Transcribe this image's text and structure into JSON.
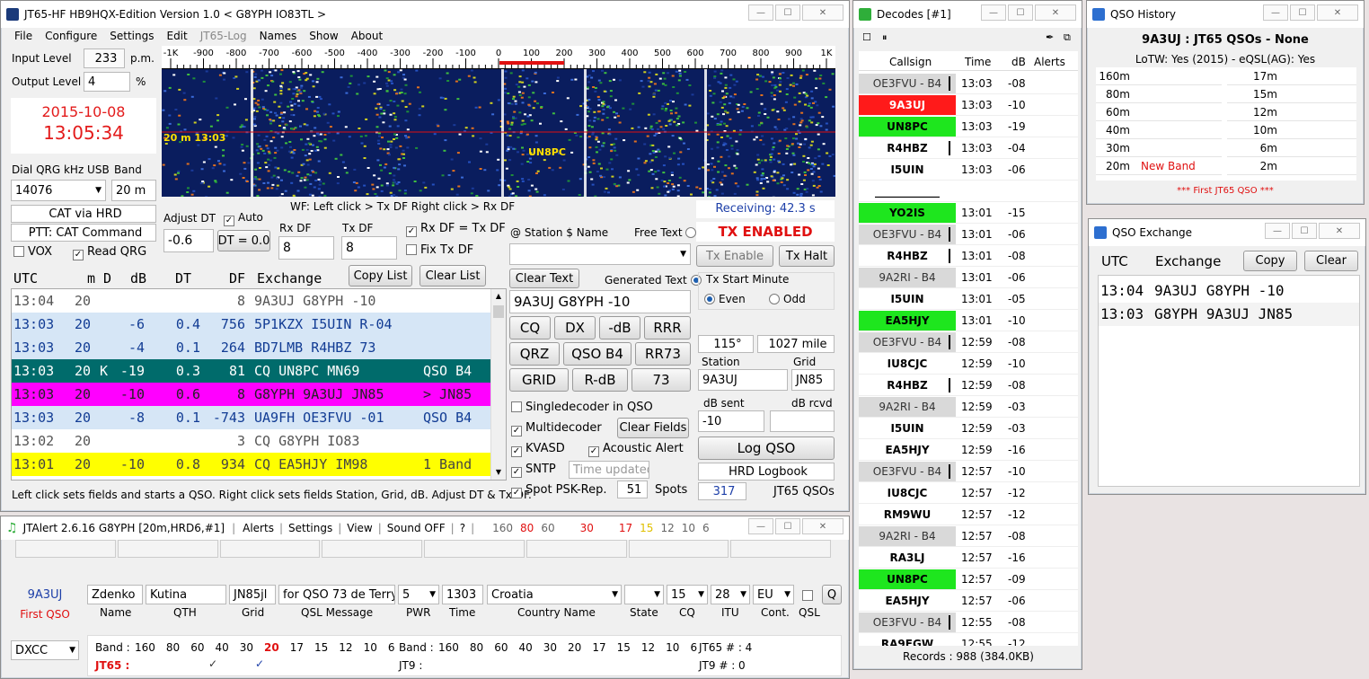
{
  "jt65": {
    "title": "JT65-HF HB9HQX-Edition Version 1.0   < G8YPH IO83TL >",
    "menu": [
      "File",
      "Configure",
      "Settings",
      "Edit",
      "JT65-Log",
      "Names",
      "Show",
      "About"
    ],
    "input_level_label": "Input Level",
    "input_level": "233",
    "pm": "p.m.",
    "output_level_label": "Output Level",
    "output_level": "4",
    "pct": "%",
    "date": "2015-10-08",
    "time": "13:05:34",
    "dial_label": "Dial QRG kHz USB",
    "band_label": "Band",
    "dial": "14076",
    "band": "20 m",
    "cat": "CAT via HRD",
    "ptt": "PTT: CAT Command",
    "vox": "VOX",
    "read_qrg": "Read QRG",
    "wf_scale": [
      "-1K",
      "-900",
      "-800",
      "-700",
      "-600",
      "-500",
      "-400",
      "-300",
      "-200",
      "-100",
      "0",
      "100",
      "200",
      "300",
      "400",
      "500",
      "600",
      "700",
      "800",
      "900",
      "1K"
    ],
    "wf_time": "20 m 13:03",
    "wf_mark": "UN8PC",
    "wf_hint": "WF: Left click > Tx DF  Right click > Rx DF",
    "adjust_dt": "Adjust DT",
    "auto": "Auto",
    "dt_value": "-0.6",
    "dt_zero": "DT = 0.0",
    "rx_df_label": "Rx DF",
    "rx_df": "8",
    "tx_df_label": "Tx DF",
    "tx_df": "8",
    "rx_eq_tx": "Rx DF = Tx DF",
    "fix_tx": "Fix Tx DF",
    "receiving": "Receiving: 42.3 s",
    "tx_enabled": "TX ENABLED",
    "station_name": "@ Station  $ Name",
    "free_text": "Free Text",
    "tx_enable": "Tx Enable",
    "tx_halt": "Tx Halt",
    "clear_text": "Clear Text",
    "generated_text": "Generated Text",
    "gen_value": "9A3UJ G8YPH -10",
    "tx_start": "Tx Start Minute",
    "even": "Even",
    "odd": "Odd",
    "macros": [
      "CQ",
      "DX",
      "-dB",
      "RRR",
      "QRZ",
      "QSO B4",
      "RR73",
      "GRID",
      "R-dB",
      "73"
    ],
    "azimuth": "115°",
    "distance": "1027 mile",
    "station_label": "Station",
    "grid_label": "Grid",
    "station": "9A3UJ",
    "grid": "JN85",
    "db_sent_label": "dB sent",
    "db_rcvd_label": "dB rcvd",
    "db_sent": "-10",
    "db_rcvd": "",
    "single": "Singledecoder in QSO",
    "multi": "Multidecoder",
    "clear_fields": "Clear Fields",
    "kvasd": "KVASD",
    "acoustic": "Acoustic Alert",
    "sntp": "SNTP",
    "time_updated": "Time updated",
    "spot": "Spot PSK-Rep.",
    "spots_n": "51",
    "spots": "Spots",
    "log_qso": "Log QSO",
    "hrd": "HRD Logbook",
    "qsos_n": "317",
    "qsos": "JT65 QSOs",
    "headers": [
      "UTC",
      "m",
      "D",
      "dB",
      "DT",
      "DF",
      "Exchange"
    ],
    "copy_list": "Copy List",
    "clear_list": "Clear List",
    "rows": [
      {
        "utc": "13:04",
        "m": "20",
        "d": "",
        "db": "",
        "dt": "",
        "df": "8",
        "ex": "9A3UJ G8YPH -10",
        "tag": "",
        "bg": "#ffffff",
        "fg": "#555555"
      },
      {
        "utc": "13:03",
        "m": "20",
        "d": "",
        "db": "-6",
        "dt": "0.4",
        "df": "756",
        "ex": "5P1KZX I5UIN R-04",
        "tag": "",
        "bg": "#d6e6f6",
        "fg": "#123c94"
      },
      {
        "utc": "13:03",
        "m": "20",
        "d": "",
        "db": "-4",
        "dt": "0.1",
        "df": "264",
        "ex": "BD7LMB R4HBZ 73",
        "tag": "",
        "bg": "#d6e6f6",
        "fg": "#123c94"
      },
      {
        "utc": "13:03",
        "m": "20",
        "d": "K",
        "db": "-19",
        "dt": "0.3",
        "df": "81",
        "ex": "CQ UN8PC MN69",
        "tag": "QSO B4",
        "bg": "#006b6b",
        "fg": "#ffffff"
      },
      {
        "utc": "13:03",
        "m": "20",
        "d": "",
        "db": "-10",
        "dt": "0.6",
        "df": "8",
        "ex": "G8YPH 9A3UJ JN85",
        "tag": "> JN85",
        "bg": "#ff00ff",
        "fg": "#222222"
      },
      {
        "utc": "13:03",
        "m": "20",
        "d": "",
        "db": "-8",
        "dt": "0.1",
        "df": "-743",
        "ex": "UA9FH OE3FVU -01",
        "tag": "QSO B4",
        "bg": "#d6e6f6",
        "fg": "#123c94"
      },
      {
        "utc": "13:02",
        "m": "20",
        "d": "",
        "db": "",
        "dt": "",
        "df": "3",
        "ex": "CQ G8YPH IO83",
        "tag": "",
        "bg": "#ffffff",
        "fg": "#555555"
      },
      {
        "utc": "13:01",
        "m": "20",
        "d": "",
        "db": "-10",
        "dt": "0.8",
        "df": "934",
        "ex": "CQ EA5HJY IM98",
        "tag": "1 Band",
        "bg": "#ffff00",
        "fg": "#444444"
      }
    ],
    "status": "Left click sets fields and starts a QSO. Right click sets fields Station, Grid, dB. Adjust DT & Tx DF."
  },
  "decodes": {
    "title": "Decodes [#1]",
    "headers": [
      "Callsign",
      "Time",
      "dB",
      "Alerts"
    ],
    "rows": [
      {
        "cs": "OE3FVU - B4",
        "t": "13:03",
        "db": "-08",
        "bg": "#d9d9d9",
        "fg": "#333333",
        "bar": true
      },
      {
        "cs": "9A3UJ",
        "t": "13:03",
        "db": "-10",
        "bg": "#ff1a1a",
        "fg": "#ffffff",
        "bar": false
      },
      {
        "cs": "UN8PC",
        "t": "13:03",
        "db": "-19",
        "bg": "#1ee61e",
        "fg": "#000000",
        "bar": false
      },
      {
        "cs": "R4HBZ",
        "t": "13:03",
        "db": "-04",
        "bg": "#ffffff",
        "fg": "#000000",
        "bar": true
      },
      {
        "cs": "I5UIN",
        "t": "13:03",
        "db": "-06",
        "bg": "#ffffff",
        "fg": "#000000",
        "bar": false
      },
      {
        "cs": "____________",
        "t": "",
        "db": "",
        "bg": "#ffffff",
        "fg": "#000000",
        "bar": false
      },
      {
        "cs": "YO2IS",
        "t": "13:01",
        "db": "-15",
        "bg": "#1ee61e",
        "fg": "#000000",
        "bar": false
      },
      {
        "cs": "OE3FVU - B4",
        "t": "13:01",
        "db": "-06",
        "bg": "#d9d9d9",
        "fg": "#333333",
        "bar": true
      },
      {
        "cs": "R4HBZ",
        "t": "13:01",
        "db": "-08",
        "bg": "#ffffff",
        "fg": "#000000",
        "bar": true
      },
      {
        "cs": "9A2RI - B4",
        "t": "13:01",
        "db": "-06",
        "bg": "#d9d9d9",
        "fg": "#333333",
        "bar": false
      },
      {
        "cs": "I5UIN",
        "t": "13:01",
        "db": "-05",
        "bg": "#ffffff",
        "fg": "#000000",
        "bar": false
      },
      {
        "cs": "EA5HJY",
        "t": "13:01",
        "db": "-10",
        "bg": "#1ee61e",
        "fg": "#000000",
        "bar": false
      },
      {
        "cs": "OE3FVU - B4",
        "t": "12:59",
        "db": "-08",
        "bg": "#d9d9d9",
        "fg": "#333333",
        "bar": true
      },
      {
        "cs": "IU8CJC",
        "t": "12:59",
        "db": "-10",
        "bg": "#ffffff",
        "fg": "#000000",
        "bar": false
      },
      {
        "cs": "R4HBZ",
        "t": "12:59",
        "db": "-08",
        "bg": "#ffffff",
        "fg": "#000000",
        "bar": true
      },
      {
        "cs": "9A2RI - B4",
        "t": "12:59",
        "db": "-03",
        "bg": "#d9d9d9",
        "fg": "#333333",
        "bar": false
      },
      {
        "cs": "I5UIN",
        "t": "12:59",
        "db": "-03",
        "bg": "#ffffff",
        "fg": "#000000",
        "bar": false
      },
      {
        "cs": "EA5HJY",
        "t": "12:59",
        "db": "-16",
        "bg": "#ffffff",
        "fg": "#000000",
        "bar": false
      },
      {
        "cs": "OE3FVU - B4",
        "t": "12:57",
        "db": "-10",
        "bg": "#d9d9d9",
        "fg": "#333333",
        "bar": true
      },
      {
        "cs": "IU8CJC",
        "t": "12:57",
        "db": "-12",
        "bg": "#ffffff",
        "fg": "#000000",
        "bar": false
      },
      {
        "cs": "RM9WU",
        "t": "12:57",
        "db": "-12",
        "bg": "#ffffff",
        "fg": "#000000",
        "bar": false
      },
      {
        "cs": "9A2RI - B4",
        "t": "12:57",
        "db": "-08",
        "bg": "#d9d9d9",
        "fg": "#333333",
        "bar": false
      },
      {
        "cs": "RA3LJ",
        "t": "12:57",
        "db": "-16",
        "bg": "#ffffff",
        "fg": "#000000",
        "bar": false
      },
      {
        "cs": "UN8PC",
        "t": "12:57",
        "db": "-09",
        "bg": "#1ee61e",
        "fg": "#000000",
        "bar": false
      },
      {
        "cs": "EA5HJY",
        "t": "12:57",
        "db": "-06",
        "bg": "#ffffff",
        "fg": "#000000",
        "bar": false
      },
      {
        "cs": "OE3FVU - B4",
        "t": "12:55",
        "db": "-08",
        "bg": "#d9d9d9",
        "fg": "#333333",
        "bar": true
      },
      {
        "cs": "RA9FGW",
        "t": "12:55",
        "db": "-12",
        "bg": "#ffffff",
        "fg": "#000000",
        "bar": false
      }
    ],
    "records": "Records : 988  (384.0KB)"
  },
  "history": {
    "title": "QSO History",
    "heading": "9A3UJ : JT65 QSOs - None",
    "lotw": "LoTW: Yes (2015) - eQSL(AG): Yes",
    "bands_left": [
      {
        "b": "160m",
        "n": ""
      },
      {
        "b": "80m",
        "n": ""
      },
      {
        "b": "60m",
        "n": ""
      },
      {
        "b": "40m",
        "n": ""
      },
      {
        "b": "30m",
        "n": ""
      },
      {
        "b": "20m",
        "n": "New Band"
      }
    ],
    "bands_right": [
      {
        "b": "17m"
      },
      {
        "b": "15m"
      },
      {
        "b": "12m"
      },
      {
        "b": "10m"
      },
      {
        "b": "6m"
      },
      {
        "b": "2m"
      }
    ],
    "footer": "***  First JT65 QSO  ***"
  },
  "exchange": {
    "title": "QSO Exchange",
    "utc": "UTC",
    "exchange": "Exchange",
    "copy": "Copy",
    "clear": "Clear",
    "rows": [
      {
        "t": "13:04",
        "m": "9A3UJ G8YPH -10"
      },
      {
        "t": "13:03",
        "m": "G8YPH 9A3UJ JN85"
      }
    ]
  },
  "jtalert": {
    "title": "JTAlert 2.6.16 G8YPH [20m,HRD6,#1]",
    "menu": [
      "Alerts",
      "Settings",
      "View",
      "Sound OFF",
      "?"
    ],
    "bands_title": [
      "160",
      "80",
      "60",
      "30",
      "17",
      "15",
      "12",
      "10",
      "6"
    ],
    "call": "9A3UJ",
    "first_qso": "First QSO",
    "name": "Zdenko",
    "qth": "Kutina",
    "grid": "JN85jl",
    "qsl_msg": "for QSO 73 de Terry",
    "pwr": "5",
    "time": "1303",
    "country": "Croatia",
    "state": "",
    "cq": "15",
    "itu": "28",
    "cont": "EU",
    "labels": [
      "Name",
      "QTH",
      "Grid",
      "QSL Message",
      "PWR",
      "Time",
      "Country Name",
      "State",
      "CQ",
      "ITU",
      "Cont.",
      "QSL"
    ],
    "q": "Q",
    "dxcc": "DXCC",
    "band_lbl": "Band :",
    "band_list": [
      "160",
      "80",
      "60",
      "40",
      "30",
      "20",
      "17",
      "15",
      "12",
      "10",
      "6"
    ],
    "jt65": "JT65 :",
    "jt9": "JT9 :",
    "jt65n": "JT65 # : 4",
    "jt9n": "JT9 # : 0",
    "checks": [
      "✓",
      "✓"
    ]
  }
}
